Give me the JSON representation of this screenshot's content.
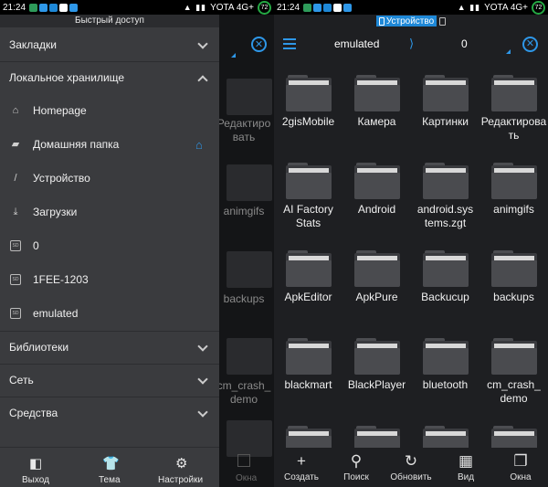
{
  "status_bar": {
    "time": "21:24",
    "carrier": "YOTA 4G+",
    "battery": "72",
    "signal_icons": "▲ ▮▮"
  },
  "right_panel": {
    "device_tab": "Устройство",
    "path": [
      "emulated",
      "0"
    ],
    "path_separator": "⟩",
    "folders": [
      "2gisMobile",
      "Камера",
      "Картинки",
      "Редактирова ть",
      "AI Factory Stats",
      "Android",
      "android.sys tems.zgt",
      "animgifs",
      "ApkEditor",
      "ApkPure",
      "Backucup",
      "backups",
      "blackmart",
      "BlackPlayer",
      "bluetooth",
      "cm_crash_ demo",
      "",
      "",
      "",
      ""
    ],
    "bottom_bar": [
      {
        "label": "Создать",
        "icon": "plus-icon"
      },
      {
        "label": "Поиск",
        "icon": "search-icon"
      },
      {
        "label": "Обновить",
        "icon": "refresh-icon"
      },
      {
        "label": "Вид",
        "icon": "grid-view-icon"
      },
      {
        "label": "Окна",
        "icon": "windows-icon"
      }
    ]
  },
  "background": {
    "folder_fragments": [
      "Редактиро вать",
      "animgifs",
      "backups",
      "cm_crash_ demo"
    ],
    "bottom_label": "Окна"
  },
  "drawer": {
    "header": "Быстрый доступ",
    "sections": {
      "bookmarks": "Закладки",
      "local_storage": "Локальное хранилище",
      "libraries": "Библиотеки",
      "network": "Сеть",
      "tools": "Средства"
    },
    "local_items": [
      {
        "label": "Homepage",
        "icon": "home-outline-icon"
      },
      {
        "label": "Домашняя папка",
        "icon": "folder-home-icon"
      },
      {
        "label": "Устройство",
        "icon": "slash-icon"
      },
      {
        "label": "Загрузки",
        "icon": "download-icon"
      },
      {
        "label": "0",
        "icon": "sd-card-icon"
      },
      {
        "label": "1FEE-1203",
        "icon": "sd-card-icon"
      },
      {
        "label": "emulated",
        "icon": "sd-card-icon"
      }
    ],
    "bottom": [
      {
        "label": "Выход",
        "icon": "exit-icon"
      },
      {
        "label": "Тема",
        "icon": "tshirt-icon"
      },
      {
        "label": "Настройки",
        "icon": "gear-icon"
      }
    ]
  },
  "colors": {
    "accent": "#2e97e8",
    "panel_bg": "#1e1f22",
    "drawer_bg": "#3a3b3e",
    "battery_ring": "#25a844"
  }
}
